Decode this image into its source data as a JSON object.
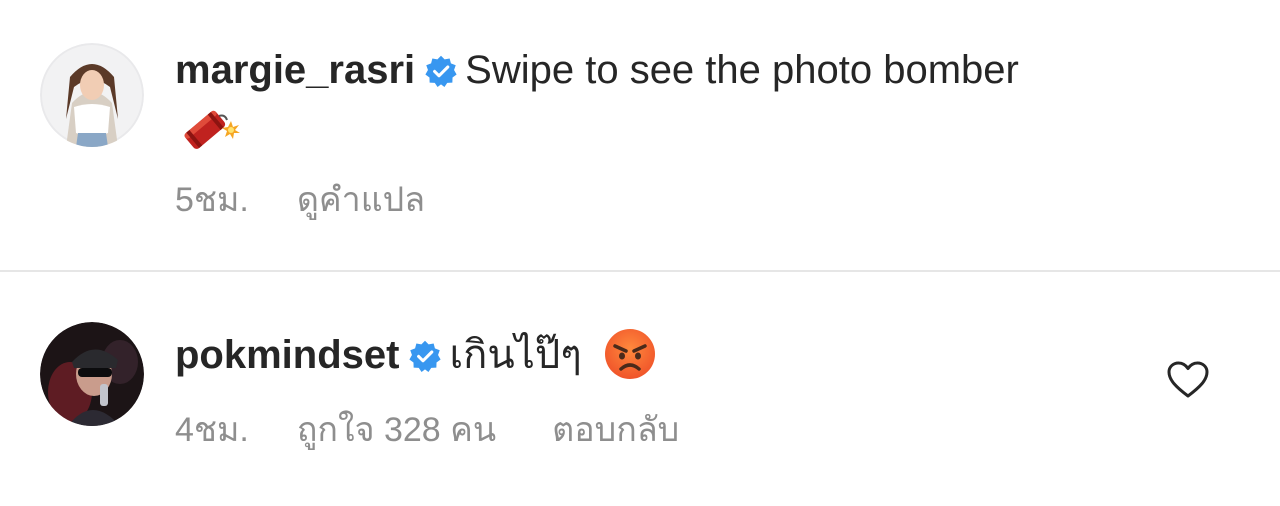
{
  "comments": [
    {
      "username": "margie_rasri",
      "verified": true,
      "text": "Swipe to see the photo bomber",
      "trailing_emoji": "firecracker",
      "time": "5ชม.",
      "translate": "ดูคำแปล"
    },
    {
      "username": "pokmindset",
      "verified": true,
      "text": "เกินไป๊ๆ",
      "trailing_emoji": "angry-face",
      "time": "4ชม.",
      "likes": "ถูกใจ 328 คน",
      "reply": "ตอบกลับ"
    }
  ],
  "colors": {
    "verified_blue": "#3897f0",
    "meta_gray": "#8e8e8e",
    "divider": "#e6e6e6"
  }
}
